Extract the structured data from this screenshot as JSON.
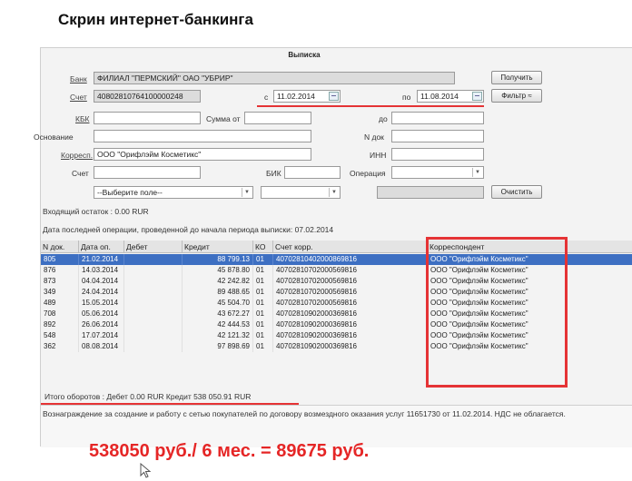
{
  "slide": {
    "title": "Скрин интернет-банкинга",
    "calculation": "538050 руб./ 6 мес. = 89675 руб."
  },
  "window": {
    "title": "Выписка"
  },
  "form": {
    "bank_label": "Банк",
    "bank_value": "ФИЛИАЛ \"ПЕРМСКИЙ\" ОАО \"УБРИР\"",
    "account_label": "Счет",
    "account_value": "40802810764100000248",
    "from_label": "с",
    "from_date": "11.02.2014",
    "to_label": "по",
    "to_date": "11.08.2014",
    "kbk_label": "КБК",
    "kbk_value": "",
    "amount_from_label": "Сумма от",
    "amount_from_value": "",
    "amount_to_label": "до",
    "amount_to_value": "",
    "basis_label": "Основание",
    "basis_value": "",
    "ndoc_label": "N док",
    "ndoc_value": "",
    "corr_label": "Корресп.",
    "corr_value": "ООО \"Орифлэйм Косметикс\"",
    "inn_label": "ИНН",
    "inn_value": "",
    "acc2_label": "Счет",
    "acc2_value": "",
    "bik_label": "БИК",
    "bik_value": "",
    "operation_label": "Операция",
    "operation_value": "",
    "field_select": "--Выберите поле--",
    "field_select2": "",
    "field_value": ""
  },
  "buttons": {
    "get": "Получить",
    "filter": "Фильтр ≈",
    "clear": "Очистить"
  },
  "info": {
    "opening_balance": "Входящий остаток :  0.00  RUR",
    "last_operation": "Дата последней операции, проведенной до начала периода выписки: 07.02.2014"
  },
  "table": {
    "headers": [
      "N док.",
      "Дата оп.",
      "Дебет",
      "Кредит",
      "КО",
      "Счет корр.",
      "Корреспондент"
    ],
    "rows": [
      [
        "805",
        "21.02.2014",
        "",
        "88 799.13",
        "01",
        "40702810402000869816",
        "ООО \"Орифлэйм Косметикс\""
      ],
      [
        "876",
        "14.03.2014",
        "",
        "45 878.80",
        "01",
        "40702810702000569816",
        "ООО \"Орифлэйм Косметикс\""
      ],
      [
        "873",
        "04.04.2014",
        "",
        "42 242.82",
        "01",
        "40702810702000569816",
        "ООО \"Орифлэйм Косметикс\""
      ],
      [
        "349",
        "24.04.2014",
        "",
        "89 488.65",
        "01",
        "40702810702000569816",
        "ООО \"Орифлэйм Косметикс\""
      ],
      [
        "489",
        "15.05.2014",
        "",
        "45 504.70",
        "01",
        "40702810702000569816",
        "ООО \"Орифлэйм Косметикс\""
      ],
      [
        "708",
        "05.06.2014",
        "",
        "43 672.27",
        "01",
        "40702810902000369816",
        "ООО \"Орифлэйм Косметикс\""
      ],
      [
        "892",
        "26.06.2014",
        "",
        "42 444.53",
        "01",
        "40702810902000369816",
        "ООО \"Орифлэйм Косметикс\""
      ],
      [
        "548",
        "17.07.2014",
        "",
        "42 121.32",
        "01",
        "40702810902000369816",
        "ООО \"Орифлэйм Косметикс\""
      ],
      [
        "362",
        "08.08.2014",
        "",
        "97 898.69",
        "01",
        "40702810902000369816",
        "ООО \"Орифлэйм Косметикс\""
      ]
    ]
  },
  "totals": {
    "text": "Итого оборотов :  Дебет  0.00  RUR  Кредит  538 050.91  RUR"
  },
  "purpose": {
    "text": "Вознаграждение за создание и работу с сетью покупателей по договору возмездного оказания услуг 11651730 от 11.02.2014. НДС не облагается."
  },
  "colors": {
    "highlight": "#e53335",
    "selection": "#3d6fc2",
    "calc_text": "#e52626"
  }
}
